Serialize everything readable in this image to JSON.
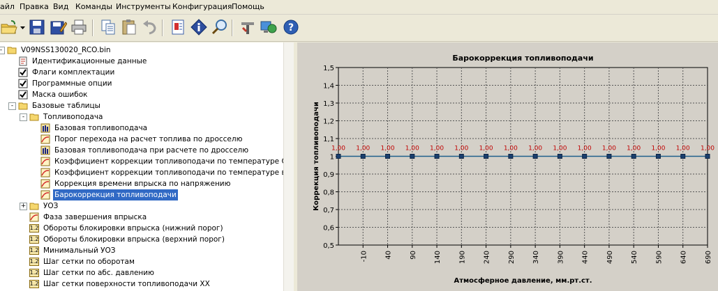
{
  "menu": [
    "айл",
    "Правка",
    "Вид",
    "Команды",
    "Инструменты",
    "Конфигурация",
    "Помощь"
  ],
  "toolbar_icons": [
    "open-folder-icon",
    "dropdown-arrow-icon",
    "save-icon",
    "save-as-icon",
    "print-icon",
    "copy-icon",
    "paste-icon",
    "undo-icon",
    "document-icon",
    "diamond-info-icon",
    "magnifier-icon",
    "tools-icon",
    "monitor-globe-icon",
    "help-icon"
  ],
  "tree": [
    {
      "label": "V09NSS130020_RCO.bin",
      "level": 0,
      "icon": "folder-icon",
      "expander": "-"
    },
    {
      "label": "Идентификационные данные",
      "level": 1,
      "icon": "doc-icon"
    },
    {
      "label": "Флаги комплектации",
      "level": 1,
      "icon": "checkbox-icon"
    },
    {
      "label": "Программные опции",
      "level": 1,
      "icon": "checkbox-icon"
    },
    {
      "label": "Маска ошибок",
      "level": 1,
      "icon": "checkbox-icon"
    },
    {
      "label": "Базовые таблицы",
      "level": 1,
      "icon": "folder-icon",
      "expander": "-"
    },
    {
      "label": "Топливоподача",
      "level": 2,
      "icon": "folder-icon",
      "expander": "-"
    },
    {
      "label": "Базовая топливоподача",
      "level": 3,
      "icon": "table-3d-icon"
    },
    {
      "label": "Порог перехода на расчет топлива по дросселю",
      "level": 3,
      "icon": "graph-icon"
    },
    {
      "label": "Базовая топливоподача при расчете по дросселю",
      "level": 3,
      "icon": "table-3d-icon"
    },
    {
      "label": "Коэффициент коррекции топливоподачи по температуре ОЖ",
      "level": 3,
      "icon": "graph-icon"
    },
    {
      "label": "Коэффициент коррекции топливоподачи по температуре возд",
      "level": 3,
      "icon": "graph-icon"
    },
    {
      "label": "Коррекция времени впрыска по напряжению",
      "level": 3,
      "icon": "graph-icon"
    },
    {
      "label": "Барокоррекция топливоподачи",
      "level": 3,
      "icon": "graph-icon",
      "selected": true
    },
    {
      "label": "УОЗ",
      "level": 2,
      "icon": "folder-icon",
      "expander": "+"
    },
    {
      "label": "Фаза завершения впрыска",
      "level": 2,
      "icon": "graph-icon"
    },
    {
      "label": "Обороты блокировки впрыска (нижний порог)",
      "level": 2,
      "icon": "value-icon"
    },
    {
      "label": "Обороты блокировки впрыска (верхний порог)",
      "level": 2,
      "icon": "value-icon"
    },
    {
      "label": "Минимальный УОЗ",
      "level": 2,
      "icon": "value-icon"
    },
    {
      "label": "Шаг сетки по оборотам",
      "level": 2,
      "icon": "value-icon"
    },
    {
      "label": "Шаг сетки по абс. давлению",
      "level": 2,
      "icon": "value-icon"
    },
    {
      "label": "Шаг сетки поверхности топливоподачи ХХ",
      "level": 2,
      "icon": "value-icon"
    }
  ],
  "value_icon_text": "1.2",
  "chart_data": {
    "type": "line",
    "title": "Барокоррекция топливоподачи",
    "xlabel": "Атмосферное давление, мм.рт.ст.",
    "ylabel": "Коррекция топливоподачи",
    "x": [
      -10,
      40,
      90,
      140,
      190,
      240,
      290,
      340,
      390,
      440,
      490,
      540,
      590,
      640,
      690
    ],
    "series": [
      {
        "values": [
          1.0,
          1.0,
          1.0,
          1.0,
          1.0,
          1.0,
          1.0,
          1.0,
          1.0,
          1.0,
          1.0,
          1.0,
          1.0,
          1.0,
          1.0,
          1.0
        ]
      }
    ],
    "point_labels": [
      "1,00",
      "1,00",
      "1,00",
      "1,00",
      "1,00",
      "1,00",
      "1,00",
      "1,00",
      "1,00",
      "1,00",
      "1,00",
      "1,00",
      "1,00",
      "1,00",
      "1,00",
      "1,00"
    ],
    "yticks": [
      "1,5",
      "1,4",
      "1,3",
      "1,2",
      "1,1",
      "1",
      "0,9",
      "0,8",
      "0,7",
      "0,6",
      "0,5"
    ],
    "ylim": [
      0.5,
      1.5
    ],
    "grid": true,
    "line_color": "#1F5F8B",
    "label_color": "#C00000"
  }
}
